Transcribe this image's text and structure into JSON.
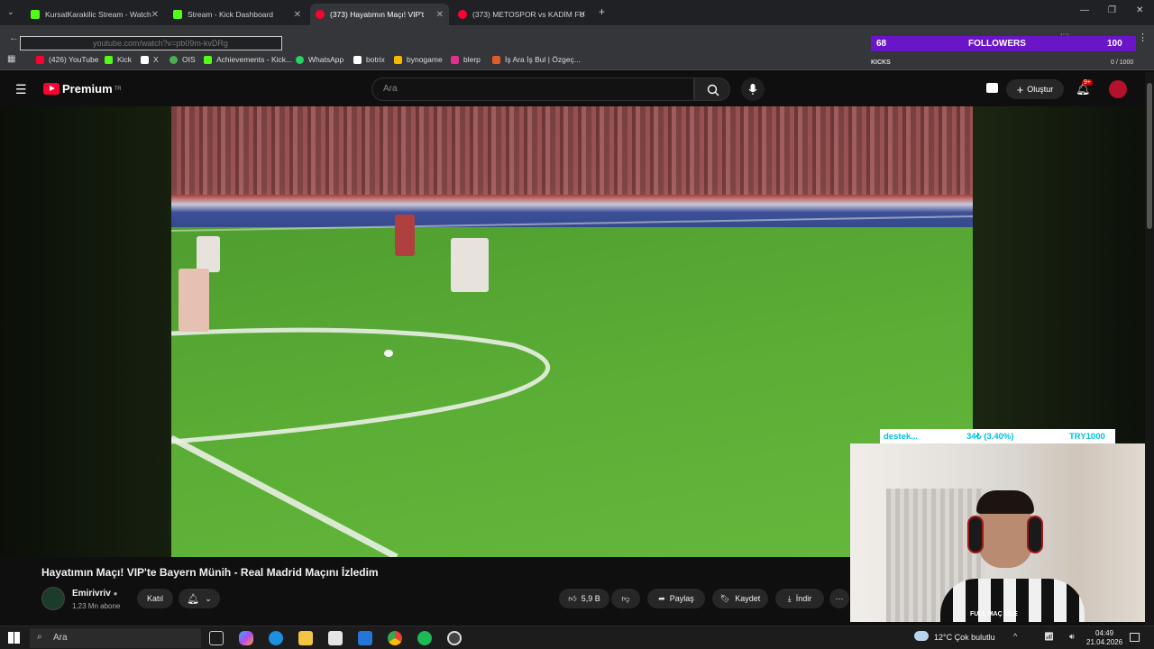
{
  "browser": {
    "tabs": [
      {
        "title": "KursatKarakilic Stream - Watch",
        "active": false,
        "favicon": "kick-icon",
        "color": "#53fc18"
      },
      {
        "title": "Stream - Kick Dashboard",
        "active": false,
        "favicon": "kick-icon",
        "color": "#53fc18"
      },
      {
        "title": "(373) Hayatımın Maçı! VIP't",
        "active": true,
        "favicon": "youtube-icon",
        "color": "#ff0033"
      },
      {
        "title": "(373) METOSPOR vs KADİM FU",
        "active": false,
        "favicon": "youtube-icon",
        "color": "#ff0033"
      }
    ],
    "url": "youtube.com/watch?v=pb09m-kvDRg",
    "bookmarks": [
      {
        "label": "(426) YouTube",
        "color": "#ff0033"
      },
      {
        "label": "Kick",
        "color": "#53fc18"
      },
      {
        "label": "X",
        "color": "#ffffff"
      },
      {
        "label": "OIS",
        "color": "#4caf50"
      },
      {
        "label": "Achievements - Kick...",
        "color": "#53fc18"
      },
      {
        "label": "WhatsApp",
        "color": "#25d366"
      },
      {
        "label": "botrix",
        "color": "#ffffff"
      },
      {
        "label": "bynogame",
        "color": "#f5b800"
      },
      {
        "label": "blerp",
        "color": "#e0308a"
      },
      {
        "label": "İş Ara İş Bul | Özgeç...",
        "color": "#e05a2a"
      }
    ]
  },
  "overlay": {
    "followers_count": "68",
    "followers_label": "FOLLOWERS",
    "followers_goal": "100",
    "kicks_label": "KICKS",
    "kicks_value": "0 / 1000",
    "donation_name": "destek...",
    "donation_progress": "34₺ (3.40%)",
    "donation_goal": "TRY1000",
    "webcam_caption": "FULL MAÇ İZLE"
  },
  "youtube": {
    "logo_text": "Premium",
    "logo_region": "TR",
    "search_placeholder": "Ara",
    "create_label": "Oluştur",
    "notifications_badge": "9+",
    "video_title": "Hayatımın Maçı! VIP'te Bayern Münih - Real Madrid Maçını İzledim",
    "channel_name": "Emirivriv",
    "channel_subs": "1,23 Mn abone",
    "join_label": "Katıl",
    "likes": "5,9 B",
    "share_label": "Paylaş",
    "save_label": "Kaydet",
    "download_label": "İndir"
  },
  "taskbar": {
    "search_placeholder": "Ara",
    "weather": "12°C  Çok bulutlu",
    "time": "04:49",
    "date": "21.04.2026"
  }
}
